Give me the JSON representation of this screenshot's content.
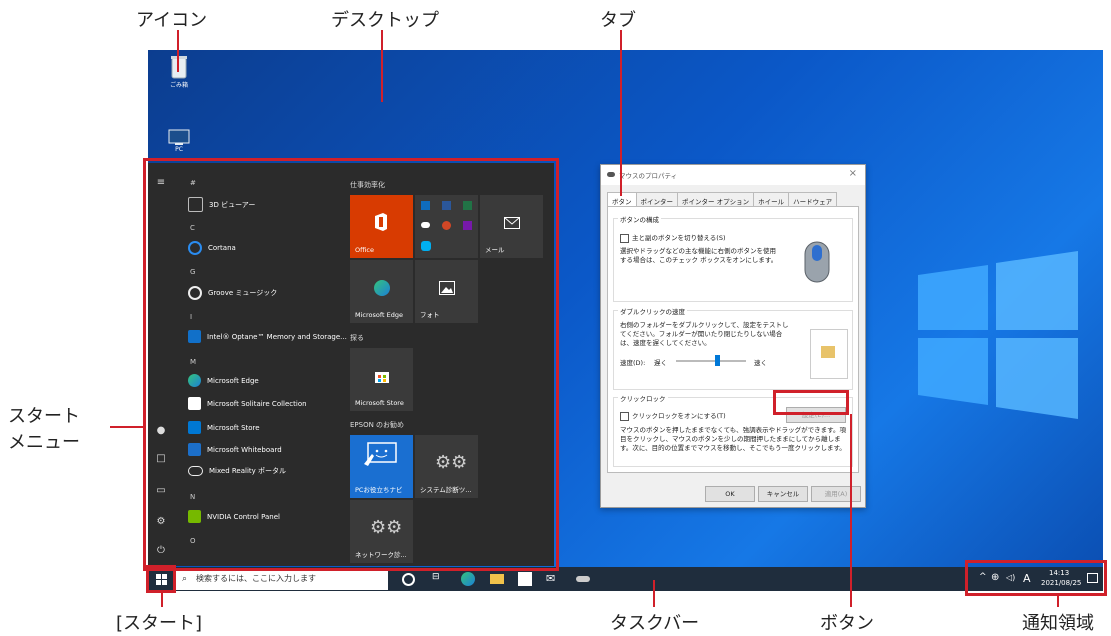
{
  "callouts": {
    "icon": "アイコン",
    "desktop": "デスクトップ",
    "tab": "タブ",
    "start_menu_line1": "スタート",
    "start_menu_line2": "メニュー",
    "start": "[スタート]",
    "taskbar": "タスクバー",
    "button": "ボタン",
    "notification_area": "通知領域"
  },
  "desktop_icons": {
    "recycle_bin": "ごみ箱",
    "pc": "PC"
  },
  "start_menu": {
    "apps": [
      {
        "letter": "#"
      },
      {
        "label": "3D ビューアー"
      },
      {
        "letter": "C"
      },
      {
        "label": "Cortana"
      },
      {
        "letter": "G"
      },
      {
        "label": "Groove ミュージック"
      },
      {
        "letter": "I"
      },
      {
        "label": "Intel® Optane™ Memory and Storage..."
      },
      {
        "letter": "M"
      },
      {
        "label": "Microsoft Edge"
      },
      {
        "label": "Microsoft Solitaire Collection"
      },
      {
        "label": "Microsoft Store"
      },
      {
        "label": "Microsoft Whiteboard"
      },
      {
        "label": "Mixed Reality ポータル"
      },
      {
        "letter": "N"
      },
      {
        "label": "NVIDIA Control Panel"
      },
      {
        "letter": "O"
      }
    ],
    "groups": {
      "productivity": "仕事効率化",
      "explore": "探る",
      "epson": "EPSON のお勧め"
    },
    "tiles": {
      "office": "Office",
      "mail": "メール",
      "edge": "Microsoft Edge",
      "photos": "フォト",
      "store": "Microsoft Store",
      "pc_guide": "PCお役立ちナビ",
      "system_diag": "システム診断ツ...",
      "network_diag": "ネットワーク診..."
    }
  },
  "dialog": {
    "title": "マウスのプロパティ",
    "tabs": [
      "ボタン",
      "ポインター",
      "ポインター オプション",
      "ホイール",
      "ハードウェア"
    ],
    "button_config": {
      "title": "ボタンの構成",
      "checkbox": "主と副のボタンを切り替える(S)",
      "desc": "選択やドラッグなどの主な機能に右側のボタンを使用する場合は、このチェック ボックスをオンにします。"
    },
    "double_click": {
      "title": "ダブルクリックの速度",
      "desc": "右側のフォルダーをダブルクリックして、設定をテストしてください。フォルダーが開いたり閉じたりしない場合は、速度を遅くしてください。",
      "speed_label": "速度(D):",
      "slow": "遅く",
      "fast": "速く",
      "speed_level": 0.6
    },
    "click_lock": {
      "title": "クリックロック",
      "checkbox": "クリックロックをオンにする(T)",
      "settings_button": "設定(E)...",
      "desc": "マウスのボタンを押したままでなくても、強調表示やドラッグができます。項目をクリックし、マウスのボタンを少しの期間押したままにしてから離します。次に、目的の位置までマウスを移動し、そこでもう一度クリックします。"
    },
    "ok": "OK",
    "cancel": "キャンセル",
    "apply": "適用(A)"
  },
  "taskbar": {
    "search_placeholder": "検索するには、ここに入力します",
    "ime": "A",
    "time": "14:13",
    "date": "2021/08/25"
  },
  "colors": {
    "accent_red": "#d0202a",
    "office_orange": "#d83b01",
    "tile_blue": "#0063b1",
    "taskbar": "#1f2d3d"
  }
}
